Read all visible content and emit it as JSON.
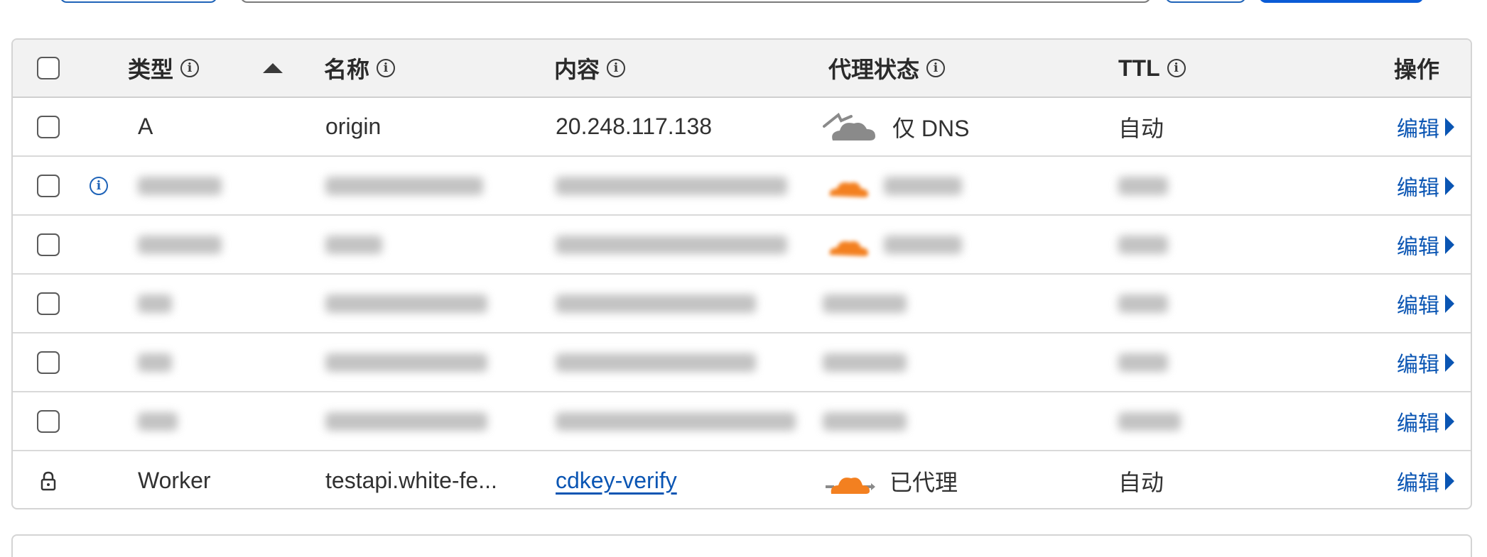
{
  "table": {
    "headers": {
      "type": "类型",
      "name": "名称",
      "content": "内容",
      "proxy_status": "代理状态",
      "ttl": "TTL",
      "actions": "操作"
    },
    "info_glyph": "i",
    "edit_label": "编辑",
    "rows": [
      {
        "type": "A",
        "name": "origin",
        "content": "20.248.117.138",
        "proxy": "仅 DNS",
        "ttl": "自动"
      },
      {
        "type": "",
        "name": "",
        "content": "",
        "proxy": "",
        "ttl": ""
      },
      {
        "type": "",
        "name": "",
        "content": "",
        "proxy": "",
        "ttl": ""
      },
      {
        "type": "",
        "name": "",
        "content": "",
        "proxy": "",
        "ttl": ""
      },
      {
        "type": "",
        "name": "",
        "content": "",
        "proxy": "",
        "ttl": ""
      },
      {
        "type": "",
        "name": "",
        "content": "",
        "proxy": "",
        "ttl": ""
      },
      {
        "type": "Worker",
        "name": "testapi.white-fe...",
        "content": "cdkey-verify",
        "proxy": "已代理",
        "ttl": "自动"
      }
    ]
  },
  "colors": {
    "link": "#0a55b3",
    "proxied_cloud": "#f38020",
    "dns_only_cloud": "#8a8a8a"
  },
  "icons": [
    "info-icon",
    "sort-ascending-icon",
    "dns-only-cloud-icon",
    "proxied-cloud-icon",
    "lock-icon",
    "chevron-right-icon"
  ]
}
